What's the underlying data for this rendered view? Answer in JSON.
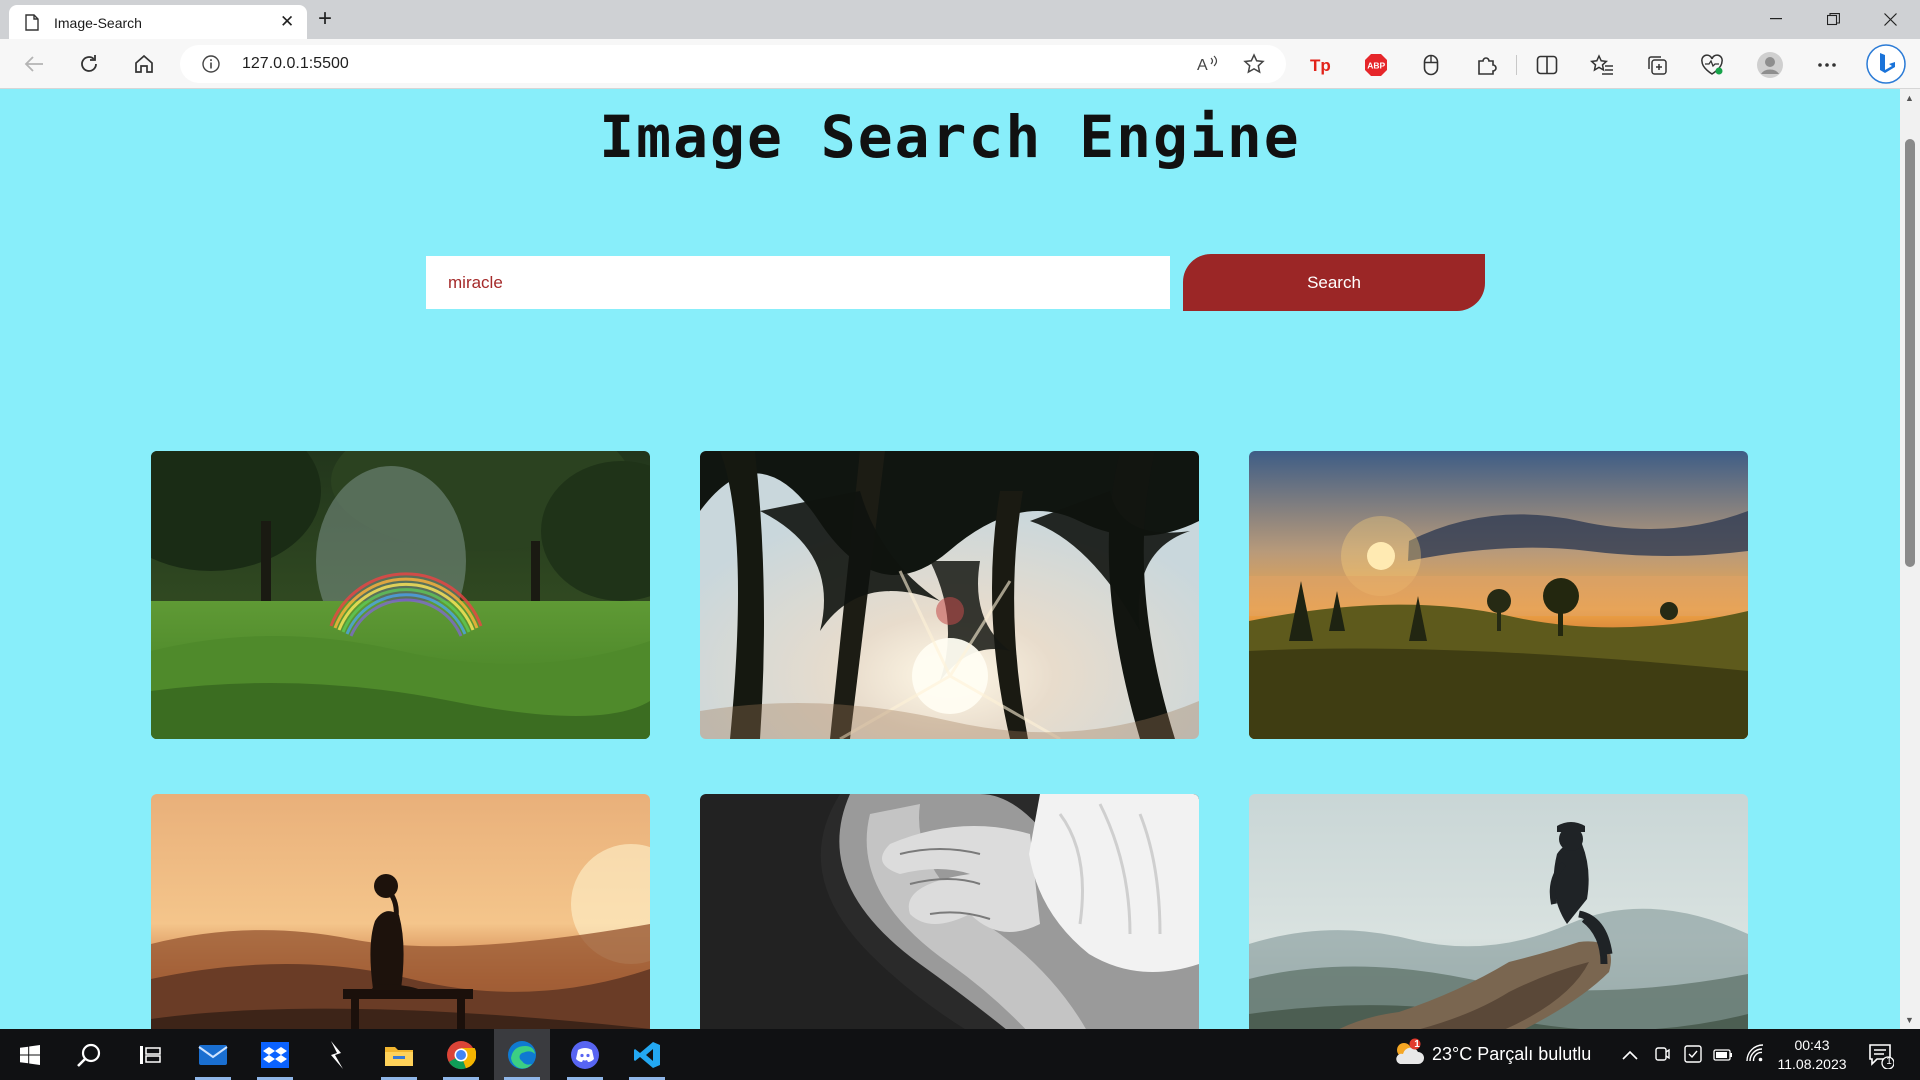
{
  "browser": {
    "tab_title": "Image-Search",
    "url": "127.0.0.1:5500"
  },
  "page": {
    "title": "Image Search Engine",
    "search_value": "miracle",
    "search_button": "Search",
    "results": [
      {
        "name": "Rainbow over a park lawn from a sprinkler"
      },
      {
        "name": "Sun shining through pine trees"
      },
      {
        "name": "Sunrise over a misty meadow"
      },
      {
        "name": "Woman on a bench watching a sunset over hills"
      },
      {
        "name": "Baby hand resting on an adult palm"
      },
      {
        "name": "Hiker sitting on a rock above misty valley"
      }
    ]
  },
  "taskbar": {
    "apps": [
      "start",
      "search",
      "task-view",
      "mail",
      "dropbox",
      "cursor",
      "file-explorer",
      "chrome",
      "edge",
      "discord",
      "vscode"
    ],
    "weather": "23°C  Parçalı bulutlu",
    "weather_badge": "1",
    "time": "00:43",
    "date": "11.08.2023",
    "notifications": "1"
  },
  "colors": {
    "page_background": "#88eefa",
    "search_button": "#9b2626",
    "search_text": "#a52a2a"
  }
}
